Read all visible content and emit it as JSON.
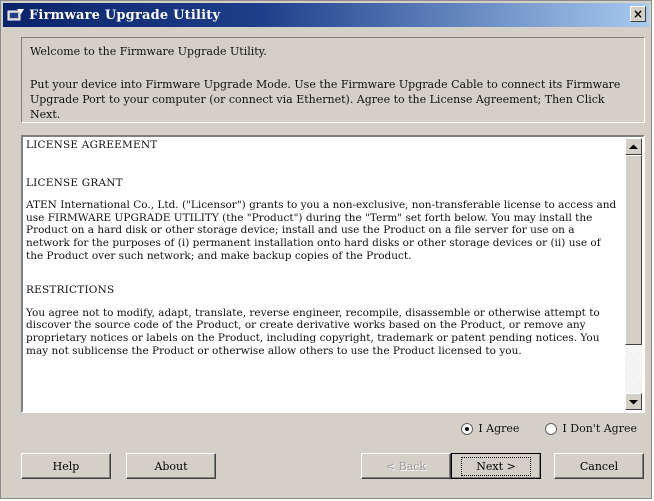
{
  "window": {
    "title": "Firmware Upgrade Utility",
    "close_glyph": "×"
  },
  "welcome": {
    "line1": "Welcome to the Firmware Upgrade Utility.",
    "line2": "Put your device into Firmware Upgrade Mode. Use the Firmware Upgrade Cable to connect its Firmware Upgrade Port to your computer (or connect via Ethernet). Agree to the License Agreement; Then Click Next."
  },
  "license": {
    "title": "LICENSE AGREEMENT",
    "grant_heading": "LICENSE GRANT",
    "grant_text": "ATEN International Co., Ltd. (\"Licensor\") grants to you a non-exclusive, non-transferable license to access and use FIRMWARE UPGRADE UTILITY (the \"Product\") during the \"Term\" set forth below. You may install the Product on a hard disk or other storage device; install and use the Product on a file server for use on a network for the purposes of (i) permanent installation onto hard disks or other storage devices or (ii) use of the Product over such network; and make backup copies of the Product.",
    "restrictions_heading": "RESTRICTIONS",
    "restrictions_text": "You agree not to modify, adapt, translate, reverse engineer, recompile, disassemble or otherwise attempt to discover the source code of the Product, or create derivative works based on the Product, or remove any proprietary notices or labels on the Product, including copyright, trademark or patent pending notices. You may not sublicense the Product or otherwise allow others to use the Product licensed to you."
  },
  "agreement": {
    "agree_label": "I Agree",
    "disagree_label": "I Don't Agree",
    "selected": "agree"
  },
  "buttons": {
    "help": "Help",
    "about": "About",
    "back": "< Back",
    "next": "Next >",
    "cancel": "Cancel"
  },
  "colors": {
    "titlebar_start": "#0a246a",
    "titlebar_end": "#a6caf0",
    "face": "#d4d0c8"
  },
  "icons": {
    "app": "app-icon",
    "close": "close-icon",
    "scroll_up": "chevron-up-icon",
    "scroll_down": "chevron-down-icon"
  }
}
